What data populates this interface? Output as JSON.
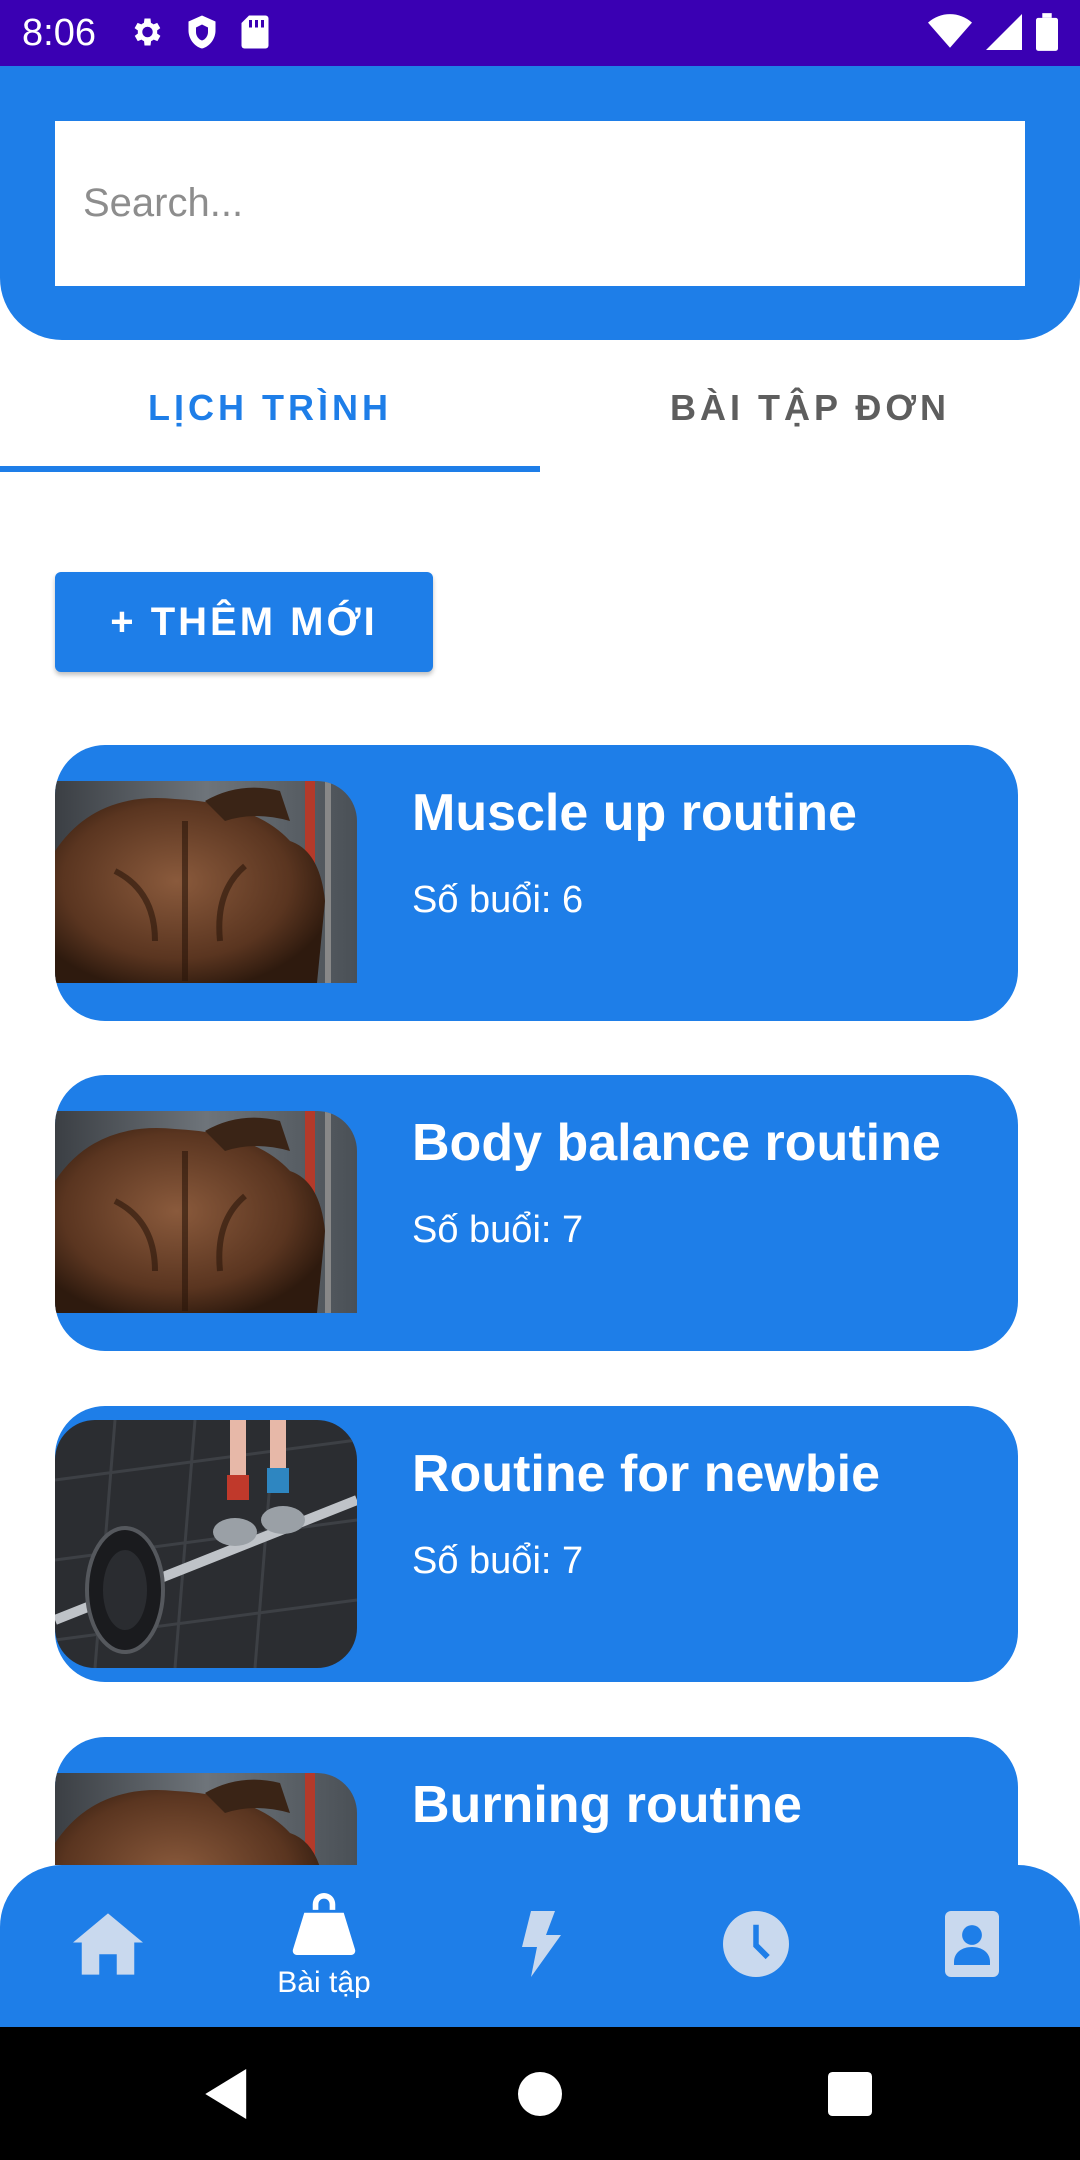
{
  "status_bar": {
    "time": "8:06",
    "icons_left": [
      "settings-icon",
      "shield-icon",
      "sd-card-icon"
    ],
    "icons_right": [
      "wifi-icon",
      "signal-icon",
      "battery-icon"
    ]
  },
  "search": {
    "placeholder": "Search..."
  },
  "tabs": [
    {
      "label": "LỊCH TRÌNH",
      "selected": true
    },
    {
      "label": "BÀI TẬP ĐƠN",
      "selected": false
    }
  ],
  "add_button": {
    "label": "+ THÊM MỚI"
  },
  "routines": [
    {
      "title": "Muscle up routine",
      "sessions": "Số buổi: 6",
      "image": "back-muscles-photo"
    },
    {
      "title": "Body balance routine",
      "sessions": "Số buổi: 7",
      "image": "back-muscles-photo"
    },
    {
      "title": "Routine for newbie",
      "sessions": "Số buổi: 7",
      "image": "barbell-deadlift-photo"
    },
    {
      "title": "Burning routine",
      "sessions": "",
      "image": "back-muscles-photo"
    }
  ],
  "bottom_nav": [
    {
      "icon": "home-icon",
      "label": ""
    },
    {
      "icon": "kettlebell-icon",
      "label": "Bài tập",
      "active": true
    },
    {
      "icon": "lightning-icon",
      "label": ""
    },
    {
      "icon": "clock-icon",
      "label": ""
    },
    {
      "icon": "contact-icon",
      "label": ""
    }
  ],
  "system_nav": [
    "back-icon",
    "home-circle-icon",
    "recents-icon"
  ],
  "colors": {
    "primary": "#1e7ee8",
    "status_bar": "#3a00b3",
    "nav_icon_inactive": "#c9d9ee",
    "tab_inactive": "#5e5e5e"
  }
}
